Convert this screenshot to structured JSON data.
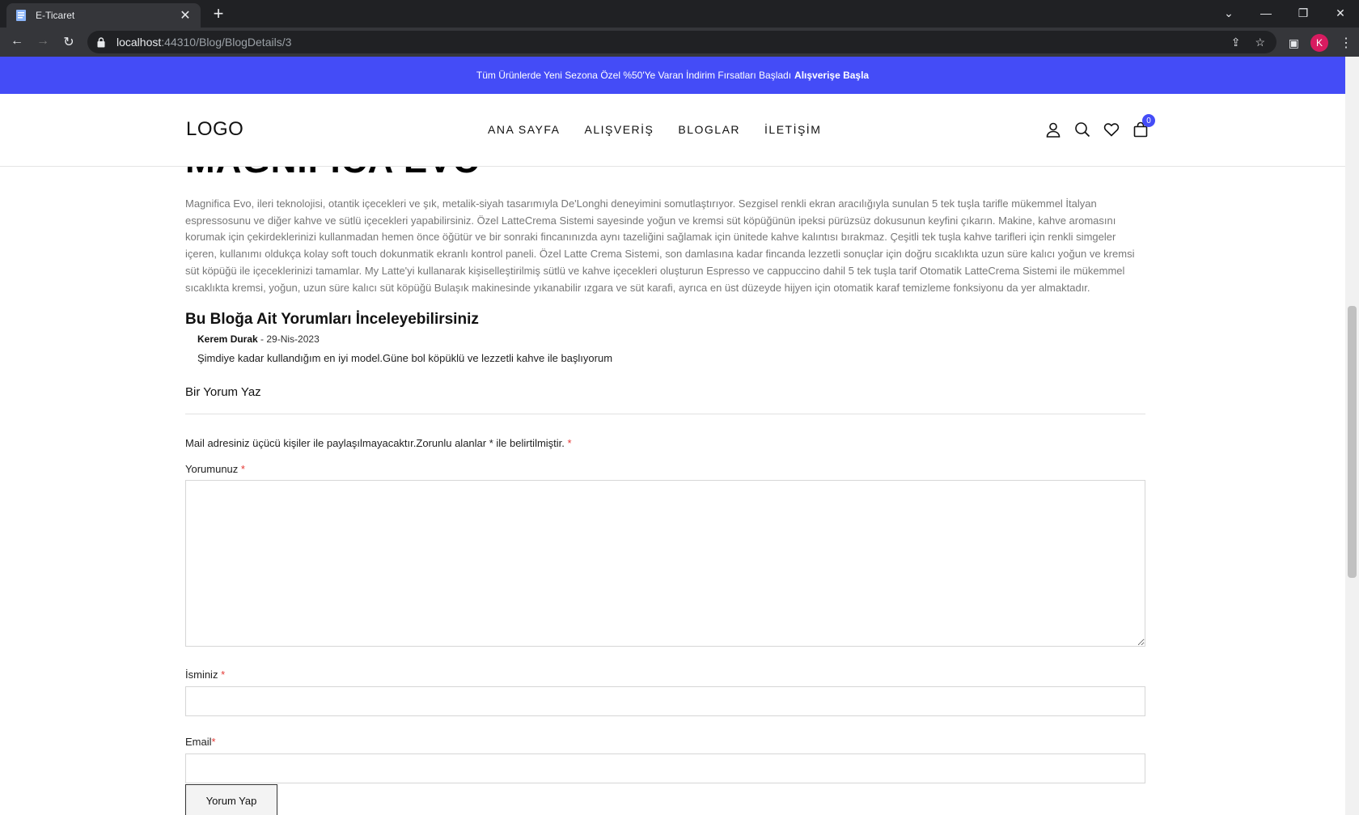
{
  "browser": {
    "tab_title": "E-Ticaret",
    "url_host": "localhost",
    "url_rest": ":44310/Blog/BlogDetails/3",
    "profile_initial": "K"
  },
  "promo": {
    "text": "Tüm Ürünlerde Yeni Sezona Özel %50'Ye Varan İndirim Fırsatları Başladı",
    "cta": "Alışverişe Başla",
    "bg_color": "#444cf7"
  },
  "header": {
    "logo": "LOGO",
    "nav": [
      "ANA SAYFA",
      "ALIŞVERİŞ",
      "BLOGLAR",
      "İLETİŞİM"
    ],
    "cart_count": "0"
  },
  "blog": {
    "title": "MAGNIFICA EVO",
    "body": "Magnifica Evo, ileri teknolojisi, otantik içecekleri ve şık, metalik-siyah tasarımıyla De'Longhi deneyimini somutlaştırıyor. Sezgisel renkli ekran aracılığıyla sunulan 5 tek tuşla tarifle mükemmel İtalyan espressosunu ve diğer kahve ve sütlü içecekleri yapabilirsiniz. Özel LatteCrema Sistemi sayesinde yoğun ve kremsi süt köpüğünün ipeksi pürüzsüz dokusunun keyfini çıkarın. Makine, kahve aromasını korumak için çekirdeklerinizi kullanmadan hemen önce öğütür ve bir sonraki fincanınızda aynı tazeliğini sağlamak için ünitede kahve kalıntısı bırakmaz. Çeşitli tek tuşla kahve tarifleri için renkli simgeler içeren, kullanımı oldukça kolay soft touch dokunmatik ekranlı kontrol paneli. Özel Latte Crema Sistemi, son damlasına kadar fincanda lezzetli sonuçlar için doğru sıcaklıkta uzun süre kalıcı yoğun ve kremsi süt köpüğü ile içeceklerinizi tamamlar. My Latte'yi kullanarak kişiselleştirilmiş sütlü ve kahve içecekleri oluşturun Espresso ve cappuccino dahil 5 tek tuşla tarif Otomatik LatteCrema Sistemi ile mükemmel sıcaklıkta kremsi, yoğun, uzun süre kalıcı süt köpüğü Bulaşık makinesinde yıkanabilir ızgara ve süt karafi, ayrıca en üst düzeyde hijyen için otomatik karaf temizleme fonksiyonu da yer almaktadır."
  },
  "comments": {
    "title": "Bu Bloğa Ait Yorumları İnceleyebilirsiniz",
    "items": [
      {
        "author": "Kerem Durak",
        "date": "- 29-Nis-2023",
        "text": "Şimdiye kadar kullandığım en iyi model.Güne bol köpüklü ve lezzetli kahve ile başlıyorum"
      }
    ]
  },
  "form": {
    "title": "Bir Yorum Yaz",
    "note": "Mail adresiniz üçücü kişiler ile paylaşılmayacaktır.Zorunlu alanlar * ile belirtilmiştir.",
    "required_mark": "*",
    "comment_label": "Yorumunuz",
    "name_label": "İsminiz",
    "email_label": "Email",
    "submit_label": "Yorum Yap"
  }
}
